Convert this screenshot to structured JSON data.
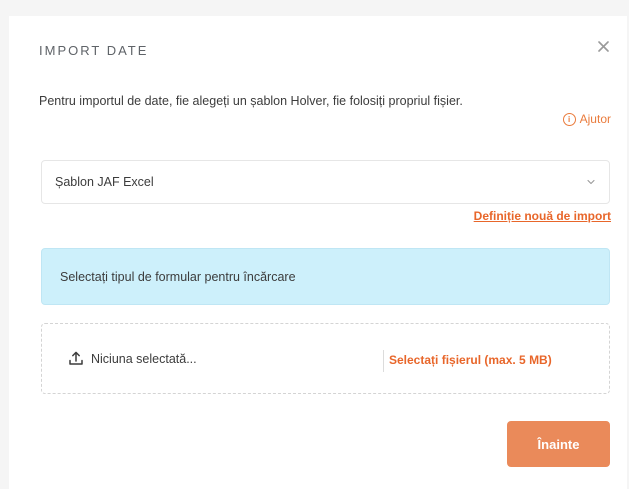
{
  "dialog": {
    "title": "IMPORT DATE",
    "close_icon": "close-icon",
    "intro": "Pentru importul de date, fie alegeți un șablon Holver, fie folosiți propriul fișier.",
    "help": {
      "icon": "info-circle-icon",
      "glyph": "i",
      "label": "Ajutor"
    }
  },
  "template_select": {
    "value": "Șablon JAF Excel",
    "icon": "chevron-down-icon"
  },
  "new_definition_link": "Definiție nouă de import",
  "info_box": {
    "text": "Selectați tipul de formular pentru încărcare"
  },
  "upload": {
    "icon": "upload-icon",
    "file_name": "Niciuna selectată...",
    "select_label": "Selectați fișierul (max. 5 MB)"
  },
  "next_button": "Înainte",
  "colors": {
    "accent": "#e8662a",
    "button": "#ea8a5a",
    "info_bg": "#cdf0fb"
  }
}
